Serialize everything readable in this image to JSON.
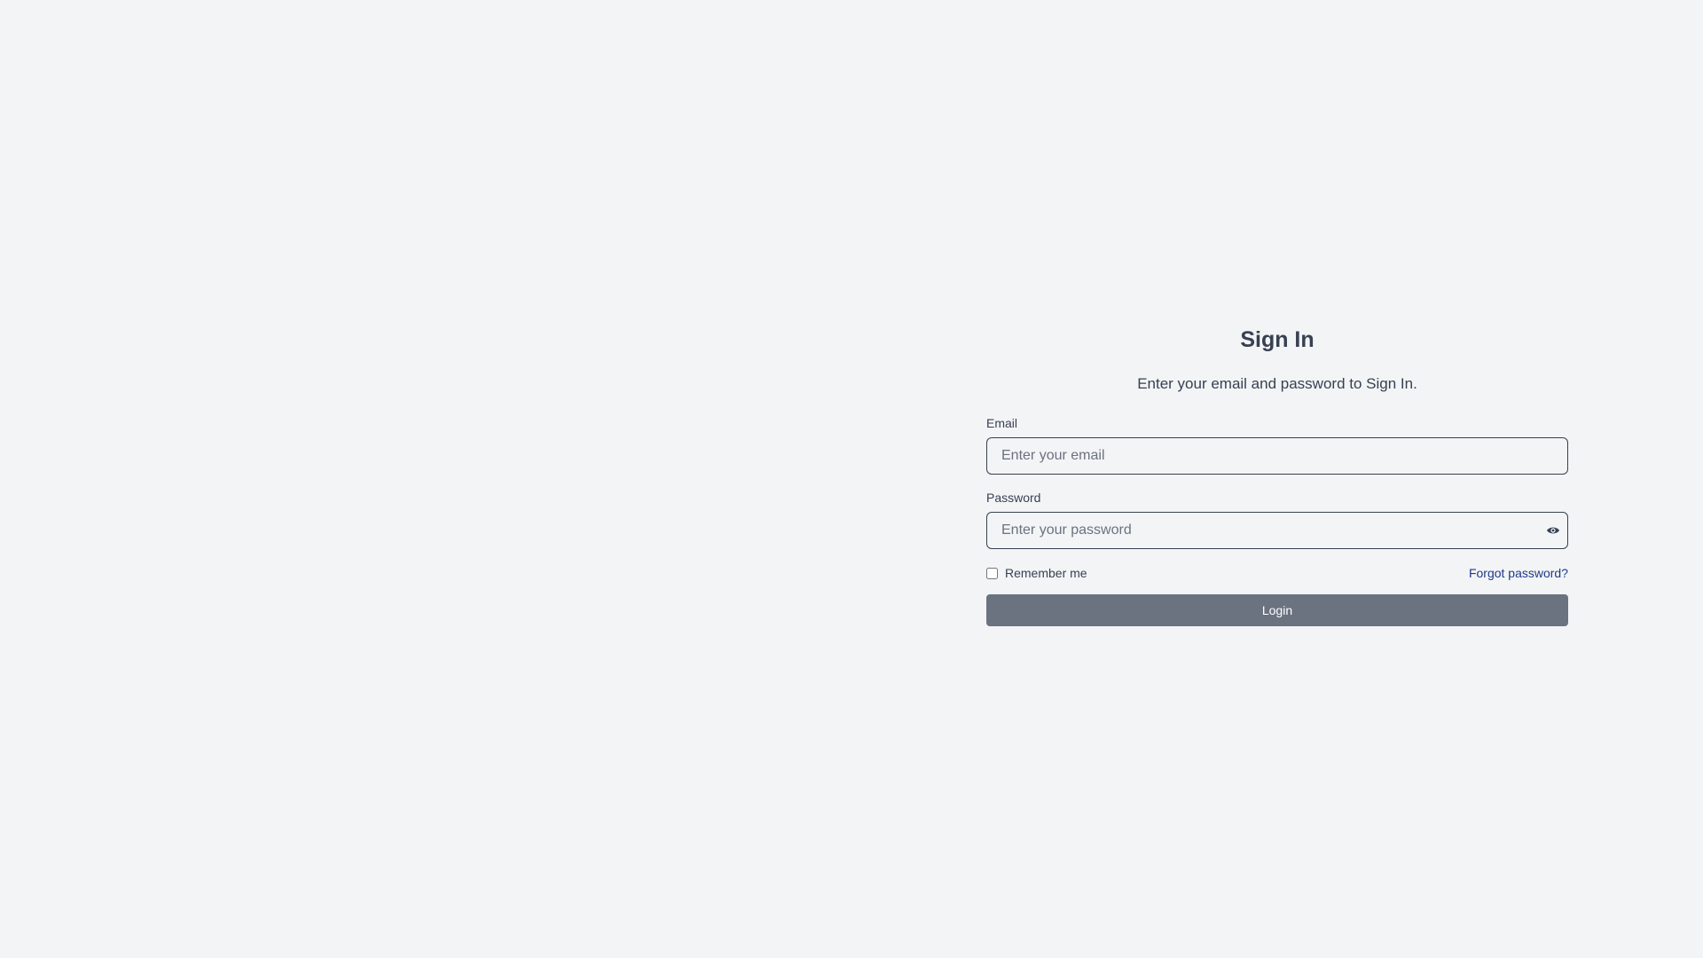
{
  "signin": {
    "title": "Sign In",
    "subtitle": "Enter your email and password to Sign In.",
    "email": {
      "label": "Email",
      "value": "",
      "placeholder": "Enter your email"
    },
    "password": {
      "label": "Password",
      "value": "",
      "placeholder": "Enter your password",
      "toggle_icon": "eye-icon"
    },
    "remember_me": {
      "label": "Remember me",
      "checked": false
    },
    "forgot_password": "Forgot password?",
    "login_button": "Login"
  },
  "colors": {
    "background": "#f3f4f6",
    "text": "#374151",
    "link": "#1e3a8a",
    "button": "#6b7280"
  }
}
